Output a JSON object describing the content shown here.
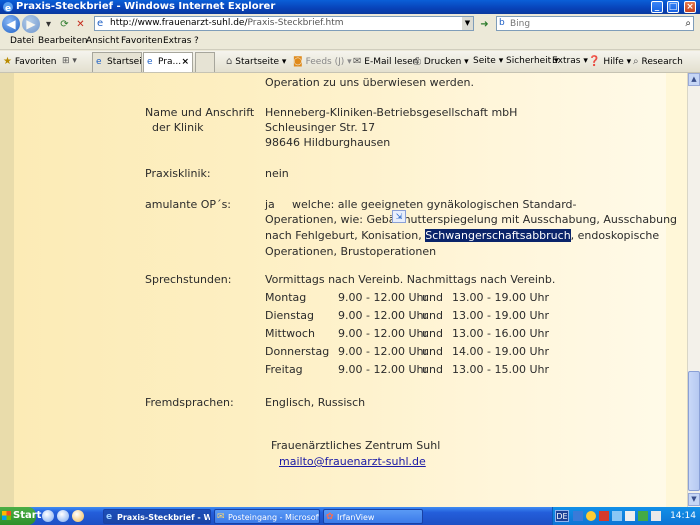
{
  "window": {
    "title": "Praxis-Steckbrief - Windows Internet Explorer",
    "minimize": "_",
    "maximize": "□",
    "close": "×"
  },
  "address": {
    "url_domain": "http://www.frauenarzt-suhl.de/",
    "url_path": "Praxis-Steckbrief.htm",
    "search_placeholder": "Bing"
  },
  "menu": {
    "items": [
      "Datei",
      "Bearbeiten",
      "Ansicht",
      "Favoriten",
      "Extras",
      "?"
    ]
  },
  "command_bar": {
    "favorites": "Favoriten",
    "tabs": [
      {
        "label": "Startseite"
      },
      {
        "label": "Pra..."
      }
    ],
    "tab_close": "×",
    "items": {
      "home": "Startseite",
      "feeds": "Feeds (J)",
      "mail": "E-Mail lesen",
      "print": "Drucken",
      "page": "Seite",
      "safety": "Sicherheit",
      "tools": "Extras",
      "help": "Hilfe",
      "research": "Research"
    }
  },
  "content": {
    "intro_tail": "Operation zu uns überwiesen werden.",
    "clinic": {
      "label_line1": "Name und Anschrift",
      "label_line2": "der Klinik",
      "name": "Henneberg-Kliniken-Betriebsgesellschaft mbH",
      "street": "Schleusinger Str. 17",
      "city": "98646 Hildburghausen"
    },
    "praxisklinik": {
      "label": "Praxisklinik:",
      "value": "nein"
    },
    "ambulante_op": {
      "label": "amulante OP´s:",
      "value_ja": "ja",
      "line1": "welche: alle geeigneten gynäkologischen Standard-",
      "line2": "Operationen, wie: Gebärmutterspiegelung mit Ausschabung, Ausschabung",
      "line3_before": "nach Fehlgeburt, Konisation,",
      "line3_selected": "Schwangerschaftsabbruch",
      "line3_after": ", endoskopische",
      "line4": "Operationen, Brustoperationen"
    },
    "sprechstunden": {
      "label": "Sprechstunden:",
      "intro": "Vormittags nach Vereinb. Nachmittags nach Vereinb.",
      "rows": [
        {
          "day": "Montag",
          "am": "9.00 - 12.00 Uhr",
          "und": "und",
          "pm": "13.00 - 19.00 Uhr"
        },
        {
          "day": "Dienstag",
          "am": "9.00 - 12.00 Uhr",
          "und": "und",
          "pm": "13.00 - 19.00 Uhr"
        },
        {
          "day": "Mittwoch",
          "am": "9.00 - 12.00 Uhr",
          "und": "und",
          "pm": "13.00 - 16.00 Uhr"
        },
        {
          "day": "Donnerstag",
          "am": "9.00 - 12.00 Uhr",
          "und": "und",
          "pm": "14.00 - 19.00 Uhr"
        },
        {
          "day": "Freitag",
          "am": "9.00 - 12.00 Uhr",
          "und": "und",
          "pm": "13.00 - 15.00 Uhr"
        }
      ]
    },
    "fremdsprachen": {
      "label": "Fremdsprachen:",
      "value": "Englisch, Russisch"
    },
    "footer": {
      "name": "Frauenärztliches Zentrum Suhl",
      "email": "mailto@frauenarzt-suhl.de"
    }
  },
  "taskbar": {
    "start": "Start",
    "buttons": [
      {
        "label": "Praxis-Steckbrief - Wi..."
      },
      {
        "label": "Posteingang - Microsoft ..."
      },
      {
        "label": "IrfanView"
      }
    ],
    "lang": "DE",
    "clock": "14:14"
  }
}
